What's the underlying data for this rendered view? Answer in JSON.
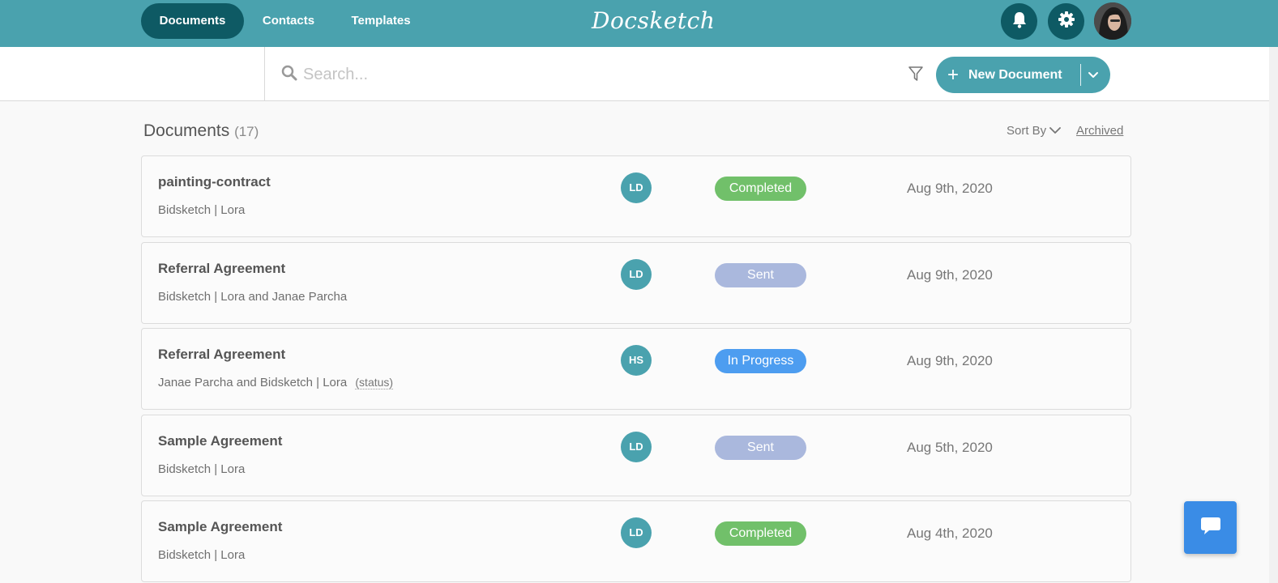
{
  "nav": {
    "tabs": [
      {
        "label": "Documents",
        "active": true
      },
      {
        "label": "Contacts",
        "active": false
      },
      {
        "label": "Templates",
        "active": false
      }
    ],
    "logo_text": "Docsketch",
    "icons": {
      "notifications": "bell-icon",
      "settings": "gear-icon",
      "avatar": "user-avatar"
    }
  },
  "search": {
    "placeholder": "Search...",
    "value": "",
    "filter_icon": "filter-icon",
    "new_document_label": "New Document"
  },
  "documents": {
    "title": "Documents",
    "count": "(17)",
    "sort_label": "Sort By",
    "archived_label": "Archived",
    "rows": [
      {
        "name": "painting-contract",
        "parties": "Bidsketch | Lora",
        "initials": "LD",
        "status": "Completed",
        "status_type": "completed",
        "date": "Aug 9th, 2020"
      },
      {
        "name": "Referral Agreement",
        "parties": "Bidsketch | Lora and Janae Parcha",
        "initials": "LD",
        "status": "Sent",
        "status_type": "sent",
        "date": "Aug 9th, 2020"
      },
      {
        "name": "Referral Agreement",
        "parties": "Janae Parcha and Bidsketch | Lora",
        "extra": "(status)",
        "initials": "HS",
        "status": "In Progress",
        "status_type": "progress",
        "date": "Aug 9th, 2020"
      },
      {
        "name": "Sample Agreement",
        "parties": "Bidsketch | Lora",
        "initials": "LD",
        "status": "Sent",
        "status_type": "sent",
        "date": "Aug 5th, 2020"
      },
      {
        "name": "Sample Agreement",
        "parties": "Bidsketch | Lora",
        "initials": "LD",
        "status": "Completed",
        "status_type": "completed",
        "date": "Aug 4th, 2020"
      }
    ]
  },
  "colors": {
    "brand": "#4aa2ae",
    "nav_active": "#0e5a64",
    "completed": "#71c06a",
    "sent": "#aab8dd",
    "in_progress": "#4d9df0",
    "chat": "#3a8ce6"
  },
  "chat": {
    "icon": "chat-bubble-icon"
  }
}
